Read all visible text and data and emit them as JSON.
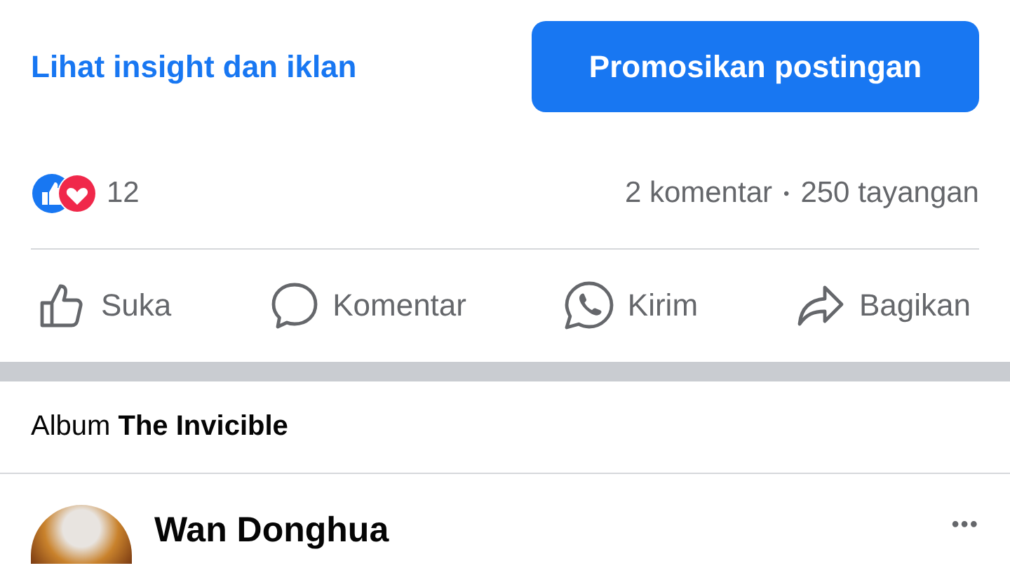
{
  "post_footer": {
    "insights_link": "Lihat insight dan iklan",
    "promote_button": "Promosikan postingan"
  },
  "reactions": {
    "count": "12",
    "comments": "2 komentar",
    "separator": "•",
    "views": "250 tayangan"
  },
  "actions": [
    {
      "kind": "like",
      "label": "Suka"
    },
    {
      "kind": "comment",
      "label": "Komentar"
    },
    {
      "kind": "whatsapp",
      "label": "Kirim"
    },
    {
      "kind": "share",
      "label": "Bagikan"
    }
  ],
  "album": {
    "text": "Album **The Invicible**"
  },
  "next_post": {
    "author": "Wan Donghua",
    "more": "•••"
  }
}
